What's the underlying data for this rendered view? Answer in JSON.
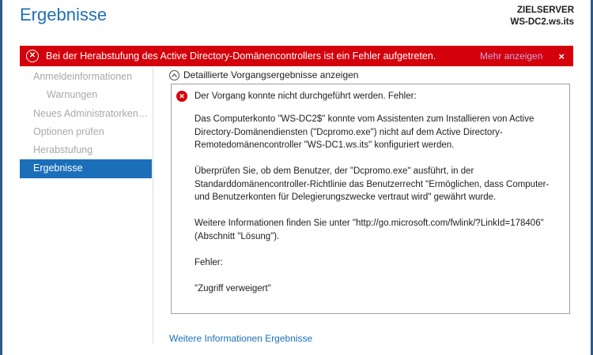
{
  "page_title": "Ergebnisse",
  "target_server": {
    "label": "ZIELSERVER",
    "name": "WS-DC2.ws.its"
  },
  "banner": {
    "message": "Bei der Herabstufung des Active Directory-Domänencontrollers ist ein Fehler aufgetreten.",
    "more_label": "Mehr anzeigen",
    "close_glyph": "×",
    "icon_glyph": "✕",
    "color": "#d4000b"
  },
  "nav": {
    "items": [
      {
        "label": "Anmeldeinformationen",
        "sub": false,
        "active": false
      },
      {
        "label": "Warnungen",
        "sub": true,
        "active": false
      },
      {
        "label": "Neues Administratorkenn...",
        "sub": false,
        "active": false
      },
      {
        "label": "Optionen prüfen",
        "sub": false,
        "active": false
      },
      {
        "label": "Herabstufung",
        "sub": false,
        "active": false
      },
      {
        "label": "Ergebnisse",
        "sub": false,
        "active": true
      }
    ],
    "active_color": "#1b6fb9"
  },
  "details": {
    "toggle_label": "Detaillierte Vorgangsergebnisse anzeigen",
    "chevron_glyph": "^",
    "error_glyph": "✕",
    "headline": "Der Vorgang konnte nicht durchgeführt werden. Fehler:",
    "paragraphs": [
      "Das Computerkonto \"WS-DC2$\" konnte vom Assistenten zum Installieren von Active Directory-Domänendiensten (\"Dcpromo.exe\") nicht auf dem Active Directory-Remotedomänencontroller \"WS-DC1.ws.its\" konfiguriert werden.",
      "Überprüfen Sie, ob dem Benutzer, der \"Dcpromo.exe\" ausführt, in der Standarddomänencontroller-Richtlinie das Benutzerrecht \"Ermöglichen, dass Computer- und Benutzerkonten für Delegierungszwecke vertraut wird\" gewährt wurde.",
      "Weitere Informationen finden Sie unter \"http://go.microsoft.com/fwlink/?LinkId=178406\" (Abschnitt \"Lösung\").",
      "Fehler:",
      "\"Zugriff verweigert\""
    ]
  },
  "more_info_link": "Weitere Informationen Ergebnisse"
}
